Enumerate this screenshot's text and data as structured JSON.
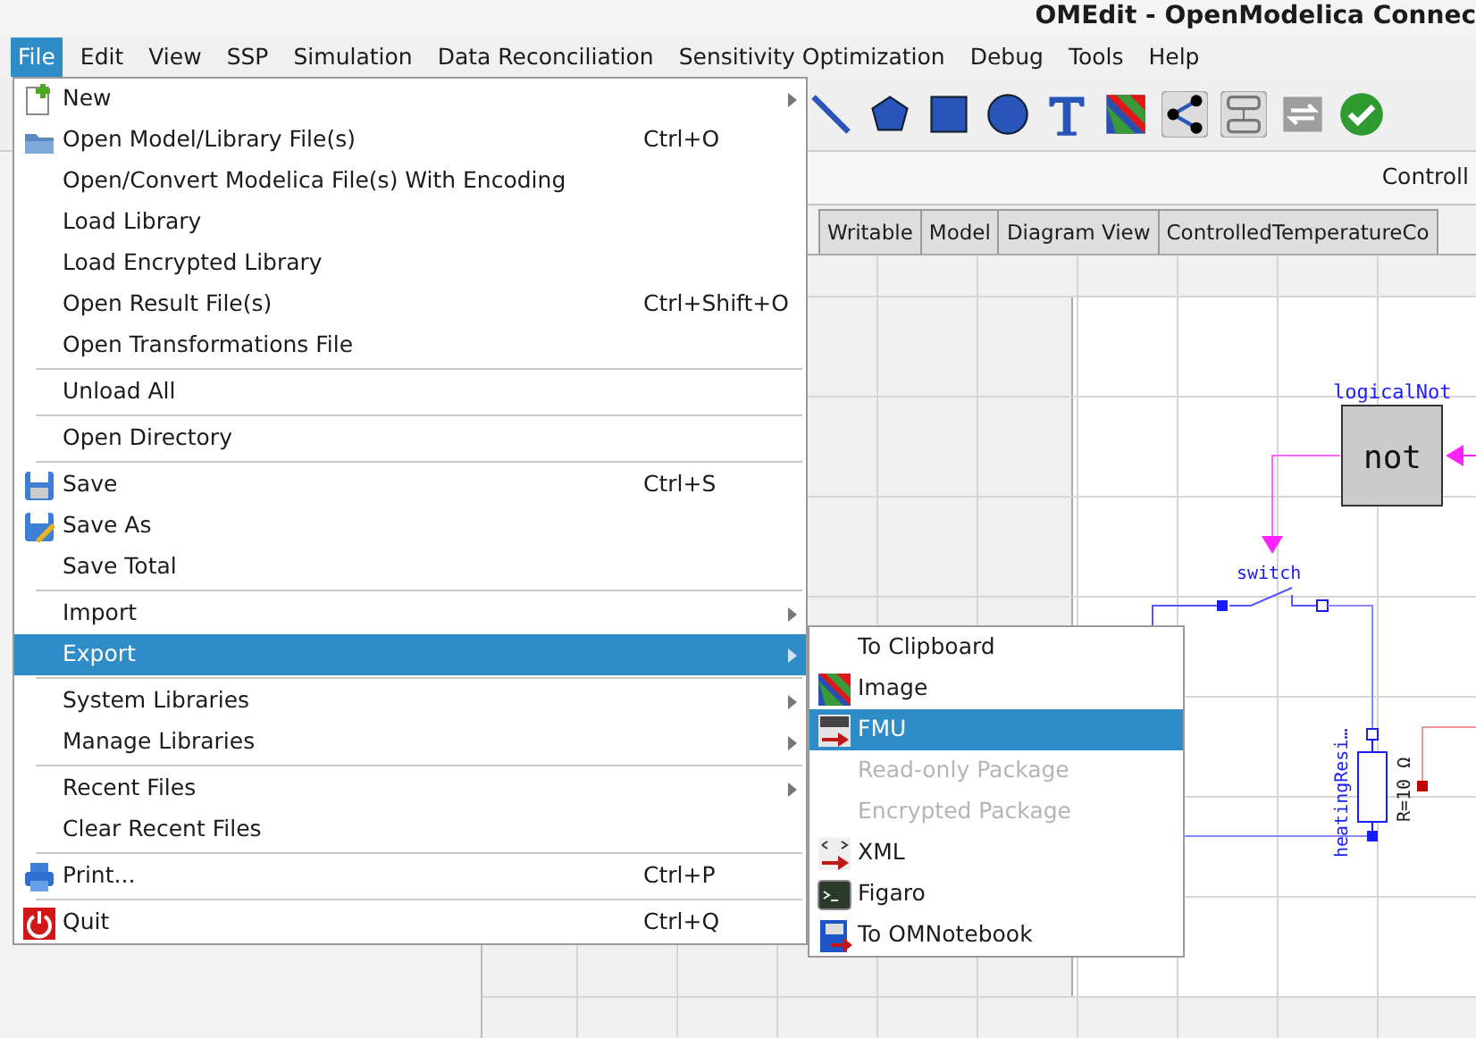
{
  "window": {
    "title": "OMEdit - OpenModelica Connec"
  },
  "menubar": [
    {
      "label": "File",
      "selected": true
    },
    {
      "label": "Edit",
      "selected": false
    },
    {
      "label": "View",
      "selected": false
    },
    {
      "label": "SSP",
      "selected": false
    },
    {
      "label": "Simulation",
      "selected": false
    },
    {
      "label": "Data Reconciliation",
      "selected": false
    },
    {
      "label": "Sensitivity Optimization",
      "selected": false
    },
    {
      "label": "Debug",
      "selected": false
    },
    {
      "label": "Tools",
      "selected": false
    },
    {
      "label": "Help",
      "selected": false
    }
  ],
  "model_header": {
    "title": "Controll"
  },
  "model_tabs": [
    {
      "label": "Writable"
    },
    {
      "label": "Model"
    },
    {
      "label": "Diagram View"
    },
    {
      "label": "ControlledTemperatureCo"
    }
  ],
  "diagram": {
    "labels": [
      {
        "kind": "block-name",
        "text": "logicalNot"
      },
      {
        "kind": "block-symbol",
        "text": "not"
      },
      {
        "kind": "switch-name",
        "text": "switch"
      },
      {
        "kind": "resistor-name",
        "text": "heatingResi…"
      },
      {
        "kind": "resistor-value",
        "text": "R=10 Ω"
      }
    ]
  },
  "file_menu": [
    {
      "kind": "item",
      "label": "New",
      "submenu": true,
      "selected": false
    },
    {
      "kind": "item",
      "label": "Open Model/Library File(s)",
      "shortcut": "Ctrl+O",
      "selected": false
    },
    {
      "kind": "item",
      "label": "Open/Convert Modelica File(s) With Encoding",
      "selected": false
    },
    {
      "kind": "item",
      "label": "Load Library",
      "selected": false
    },
    {
      "kind": "item",
      "label": "Load Encrypted Library",
      "selected": false
    },
    {
      "kind": "item",
      "label": "Open Result File(s)",
      "shortcut": "Ctrl+Shift+O",
      "selected": false
    },
    {
      "kind": "item",
      "label": "Open Transformations File",
      "selected": false
    },
    {
      "kind": "separator"
    },
    {
      "kind": "item",
      "label": "Unload All",
      "selected": false
    },
    {
      "kind": "separator"
    },
    {
      "kind": "item",
      "label": "Open Directory",
      "selected": false
    },
    {
      "kind": "separator"
    },
    {
      "kind": "item",
      "label": "Save",
      "shortcut": "Ctrl+S",
      "selected": false
    },
    {
      "kind": "item",
      "label": "Save As",
      "selected": false
    },
    {
      "kind": "item",
      "label": "Save Total",
      "selected": false
    },
    {
      "kind": "separator"
    },
    {
      "kind": "item",
      "label": "Import",
      "submenu": true,
      "selected": false
    },
    {
      "kind": "item",
      "label": "Export",
      "submenu": true,
      "selected": true
    },
    {
      "kind": "separator"
    },
    {
      "kind": "item",
      "label": "System Libraries",
      "submenu": true,
      "selected": false
    },
    {
      "kind": "item",
      "label": "Manage Libraries",
      "submenu": true,
      "selected": false
    },
    {
      "kind": "separator"
    },
    {
      "kind": "item",
      "label": "Recent Files",
      "submenu": true,
      "selected": false
    },
    {
      "kind": "item",
      "label": "Clear Recent Files",
      "selected": false
    },
    {
      "kind": "separator"
    },
    {
      "kind": "item",
      "label": "Print...",
      "shortcut": "Ctrl+P",
      "selected": false
    },
    {
      "kind": "separator"
    },
    {
      "kind": "item",
      "label": "Quit",
      "shortcut": "Ctrl+Q",
      "selected": false
    }
  ],
  "export_menu": [
    {
      "label": "To Clipboard",
      "selected": false,
      "disabled": false
    },
    {
      "label": "Image",
      "selected": false,
      "disabled": false
    },
    {
      "label": "FMU",
      "selected": true,
      "disabled": false
    },
    {
      "label": "Read-only Package",
      "selected": false,
      "disabled": true
    },
    {
      "label": "Encrypted Package",
      "selected": false,
      "disabled": true
    },
    {
      "label": "XML",
      "selected": false,
      "disabled": false
    },
    {
      "label": "Figaro",
      "selected": false,
      "disabled": false
    },
    {
      "label": "To OMNotebook",
      "selected": false,
      "disabled": false
    }
  ]
}
